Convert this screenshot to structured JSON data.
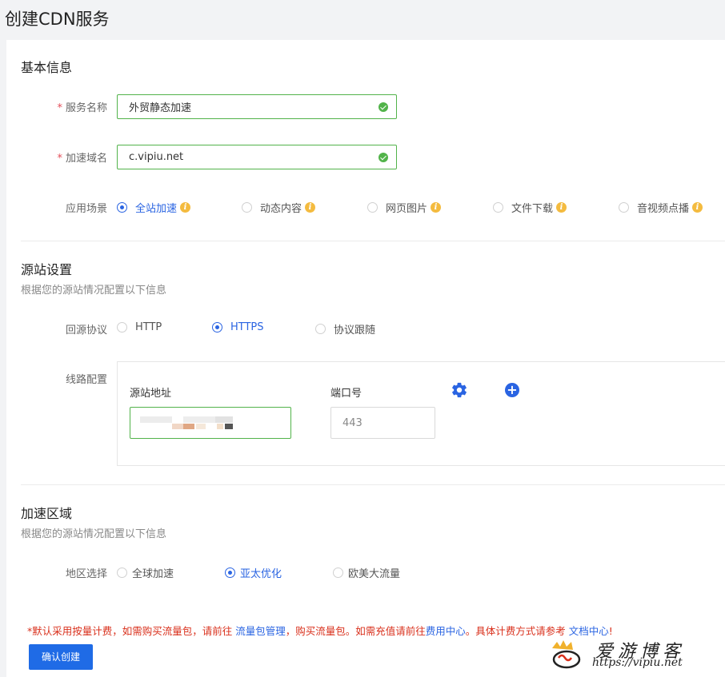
{
  "page": {
    "title": "创建CDN服务"
  },
  "basic": {
    "title": "基本信息",
    "service_name_label": "服务名称",
    "service_name_value": "外贸静态加速",
    "domain_label": "加速域名",
    "domain_value": "c.vipiu.net",
    "scene_label": "应用场景",
    "scenes": [
      {
        "label": "全站加速",
        "selected": true
      },
      {
        "label": "动态内容",
        "selected": false
      },
      {
        "label": "网页图片",
        "selected": false
      },
      {
        "label": "文件下载",
        "selected": false
      },
      {
        "label": "音视频点播",
        "selected": false
      }
    ],
    "required_mark": "*"
  },
  "origin": {
    "title": "源站设置",
    "subtitle": "根据您的源站情况配置以下信息",
    "protocol_label": "回源协议",
    "protocols": [
      {
        "label": "HTTP",
        "selected": false
      },
      {
        "label": "HTTPS",
        "selected": true
      },
      {
        "label": "协议跟随",
        "selected": false
      }
    ],
    "line_label": "线路配置",
    "addr_col": "源站地址",
    "port_col": "端口号",
    "port_placeholder": "443"
  },
  "region": {
    "title": "加速区域",
    "subtitle": "根据您的源站情况配置以下信息",
    "label": "地区选择",
    "options": [
      {
        "label": "全球加速",
        "selected": false
      },
      {
        "label": "亚太优化",
        "selected": true
      },
      {
        "label": "欧美大流量",
        "selected": false
      }
    ]
  },
  "notice": {
    "part1": "*默认采用按量计费，如需购买流量包，请前往 ",
    "link1": "流量包管理",
    "part2": "，购买流量包。如需充值请前往",
    "link2": "费用中心",
    "part3": "。具体计费方式请参考 ",
    "link3": "文档中心",
    "part4": "!"
  },
  "actions": {
    "confirm": "确认创建"
  },
  "watermark": {
    "text": "爱游博客",
    "url": "https://vipiu.net"
  },
  "colors": {
    "primary": "#1f6be6",
    "success": "#52b34a",
    "warning": "#f4bb3f",
    "danger": "#d9301c"
  }
}
